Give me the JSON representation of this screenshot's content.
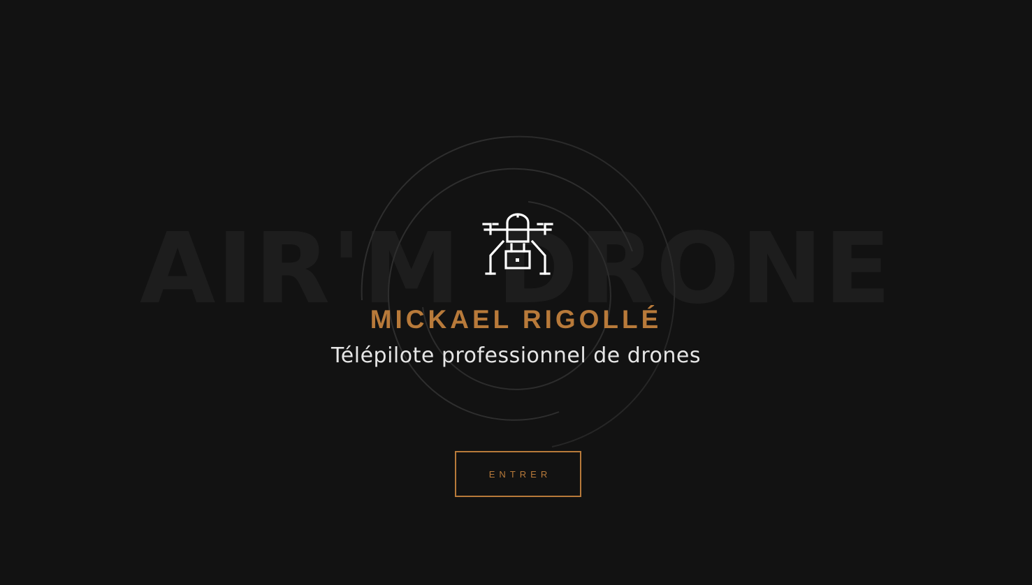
{
  "background_word": "AIR'M DRONE",
  "logo": {
    "icon": "drone-icon"
  },
  "name": "MICKAEL RIGOLLÉ",
  "subtitle": "Télépilote professionnel de drones",
  "enter_button": {
    "label": "ENTRER"
  },
  "colors": {
    "background": "#121212",
    "accent": "#b87a3a",
    "text": "#e6e6e6",
    "background_word": "#1d1d1d",
    "rings": "#2e2e2e"
  }
}
